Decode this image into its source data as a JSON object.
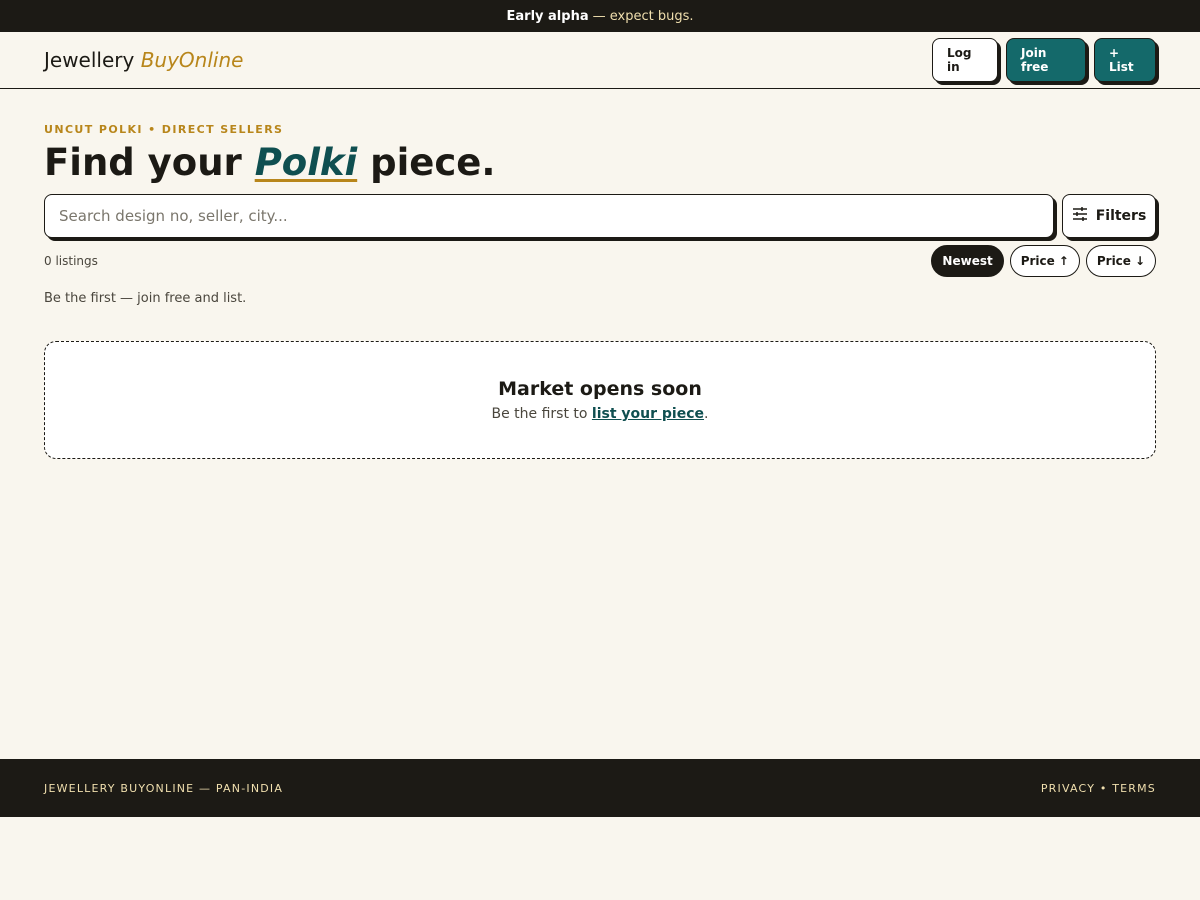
{
  "announcement": {
    "bold": "Early alpha",
    "text": "— expect bugs."
  },
  "header": {
    "logo_main": "Jewellery",
    "logo_accent": "BuyOnline",
    "login_label": "Log in",
    "join_label": "Join free",
    "list_label": "+ List"
  },
  "hero": {
    "eyebrow": "UNCUT POLKI • DIRECT SELLERS",
    "title_before": "Find your",
    "title_accent": "Polki",
    "title_after": "piece."
  },
  "search": {
    "placeholder": "Search design no, seller, city...",
    "value": "",
    "filters_label": "Filters",
    "filters_icon": "sliders-icon"
  },
  "results": {
    "count": "0 listings",
    "sort_options": [
      {
        "label": "Newest",
        "active": true
      },
      {
        "label": "Price",
        "arrow": "↑",
        "active": false
      },
      {
        "label": "Price",
        "arrow": "↓",
        "active": false
      }
    ],
    "hint": "Be the first — join free and list."
  },
  "empty_state": {
    "title": "Market opens soon",
    "text_before": "Be the first to",
    "link": "list your piece",
    "text_after": "."
  },
  "footer": {
    "left": "JEWELLERY BUYONLINE — PAN-INDIA",
    "right": "PRIVACY • TERMS"
  },
  "colors": {
    "background": "#f9f6ee",
    "ink": "#1c1a15",
    "teal": "#14696a",
    "gold": "#b8861b"
  }
}
